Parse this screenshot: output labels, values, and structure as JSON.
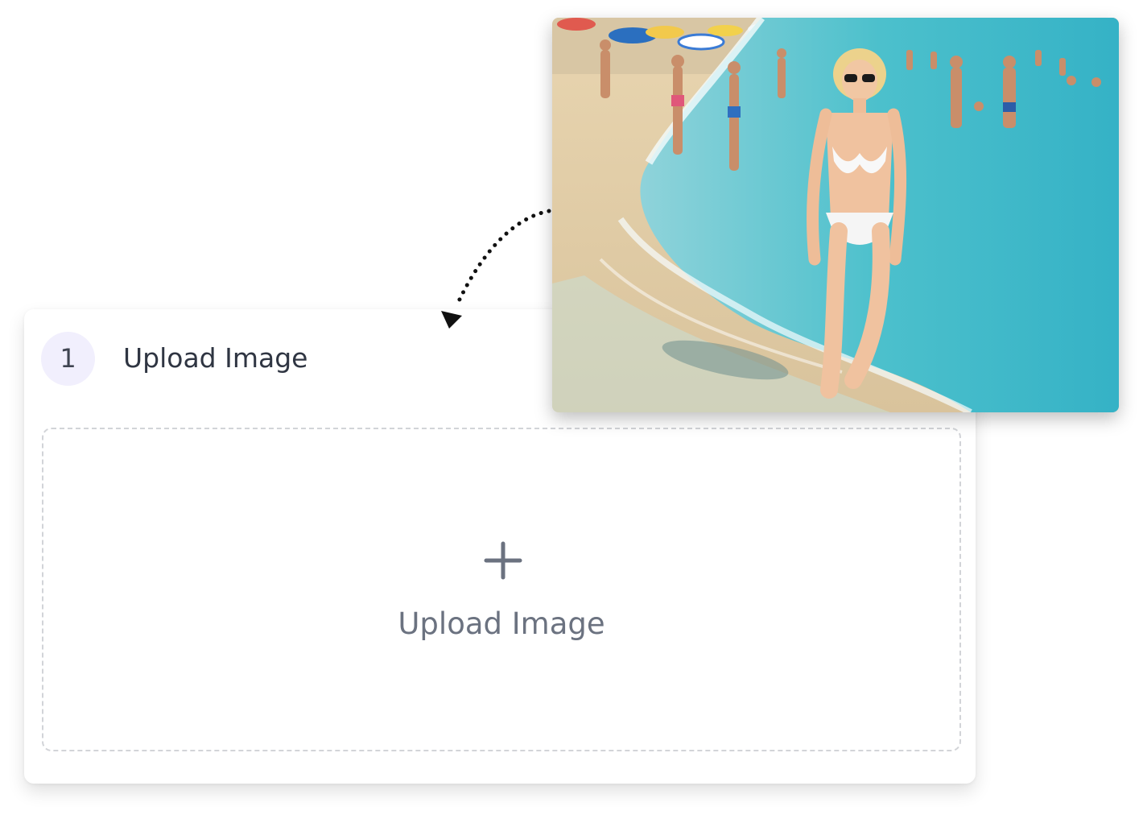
{
  "upload_card": {
    "step_number": "1",
    "step_title": "Upload Image",
    "dropzone_label": "Upload Image",
    "plus_icon": "plus-icon"
  },
  "arrow": {
    "icon": "curved-dotted-arrow-icon"
  },
  "example_photo": {
    "subject": "woman-in-white-bikini-on-beach",
    "colors": {
      "sea": "#3fb8c8",
      "sand": "#e6d3ae",
      "sky_crowd": "#d9c7a5"
    }
  },
  "colors": {
    "badge_bg": "#f1effd",
    "dropzone_border": "#d2d4d8",
    "label_text": "#6b7280",
    "title_text": "#2f3542"
  }
}
